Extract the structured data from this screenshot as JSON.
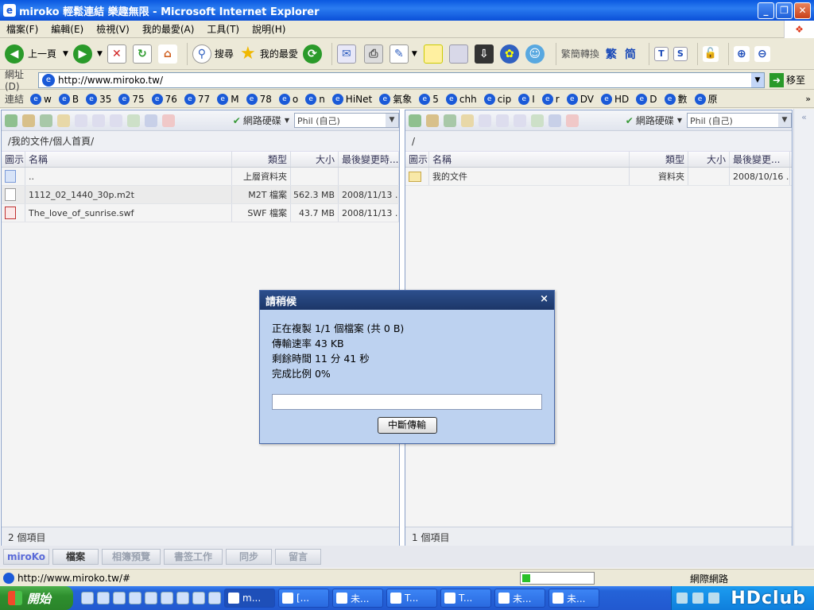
{
  "window": {
    "title": "miroko 輕鬆連結 樂趣無限 - Microsoft Internet Explorer"
  },
  "menu": [
    "檔案(F)",
    "編輯(E)",
    "檢視(V)",
    "我的最愛(A)",
    "工具(T)",
    "說明(H)"
  ],
  "toolbar": {
    "back": "上一頁",
    "search": "搜尋",
    "favorites": "我的最愛",
    "convert": "繁簡轉換",
    "trad": "繁",
    "simp": "简"
  },
  "address": {
    "label": "網址(D)",
    "url": "http://www.miroko.tw/",
    "go": "移至"
  },
  "links": {
    "label": "連結",
    "items": [
      "w",
      "B",
      "35",
      "75",
      "76",
      "77",
      "M",
      "78",
      "o",
      "n",
      "HiNet",
      "氣象",
      "5",
      "chh",
      "cip",
      "I",
      "r",
      "DV",
      "HD",
      "D",
      "數",
      "原"
    ]
  },
  "left_pane": {
    "disk_label": "網路硬碟",
    "disk_select": "Phil (自己)",
    "path": "/我的文件/個人首頁/",
    "columns": [
      "圖示",
      "名稱",
      "類型",
      "大小",
      "最後變更時..."
    ],
    "rows": [
      {
        "name": "..",
        "type": "上層資料夾",
        "size": "",
        "modified": ""
      },
      {
        "name": "1112_02_1440_30p.m2t",
        "type": "M2T 檔案",
        "size": "562.3 MB",
        "modified": "2008/11/13 ..."
      },
      {
        "name": "The_love_of_sunrise.swf",
        "type": "SWF 檔案",
        "size": "43.7 MB",
        "modified": "2008/11/13 ..."
      }
    ],
    "footer": "2 個項目"
  },
  "right_pane": {
    "disk_label": "網路硬碟",
    "disk_select": "Phil (自己)",
    "path": "/",
    "columns": [
      "圖示",
      "名稱",
      "類型",
      "大小",
      "最後變更..."
    ],
    "rows": [
      {
        "name": "我的文件",
        "type": "資料夾",
        "size": "",
        "modified": "2008/10/16 ..."
      }
    ],
    "footer": "1 個項目"
  },
  "bottom_tabs": [
    "miroKo",
    "檔案",
    "相簿預覽",
    "書签工作",
    "同步",
    "留言"
  ],
  "dialog": {
    "title": "請稍候",
    "close": "×",
    "line1": "正在複製 1/1 個檔案 (共 0 B)",
    "line2": "傳輸速率 43 KB",
    "line3": "剩餘時間 11 分 41 秒",
    "line4": "完成比例 0%",
    "progress": 0,
    "button": "中斷傳輸"
  },
  "status": {
    "url": "http://www.miroko.tw/#",
    "zone": "網際網路"
  },
  "taskbar": {
    "start": "開始",
    "tasks": [
      "m...",
      "[...",
      "未...",
      "T...",
      "T...",
      "未...",
      "未..."
    ],
    "watermark": "HDclub"
  }
}
